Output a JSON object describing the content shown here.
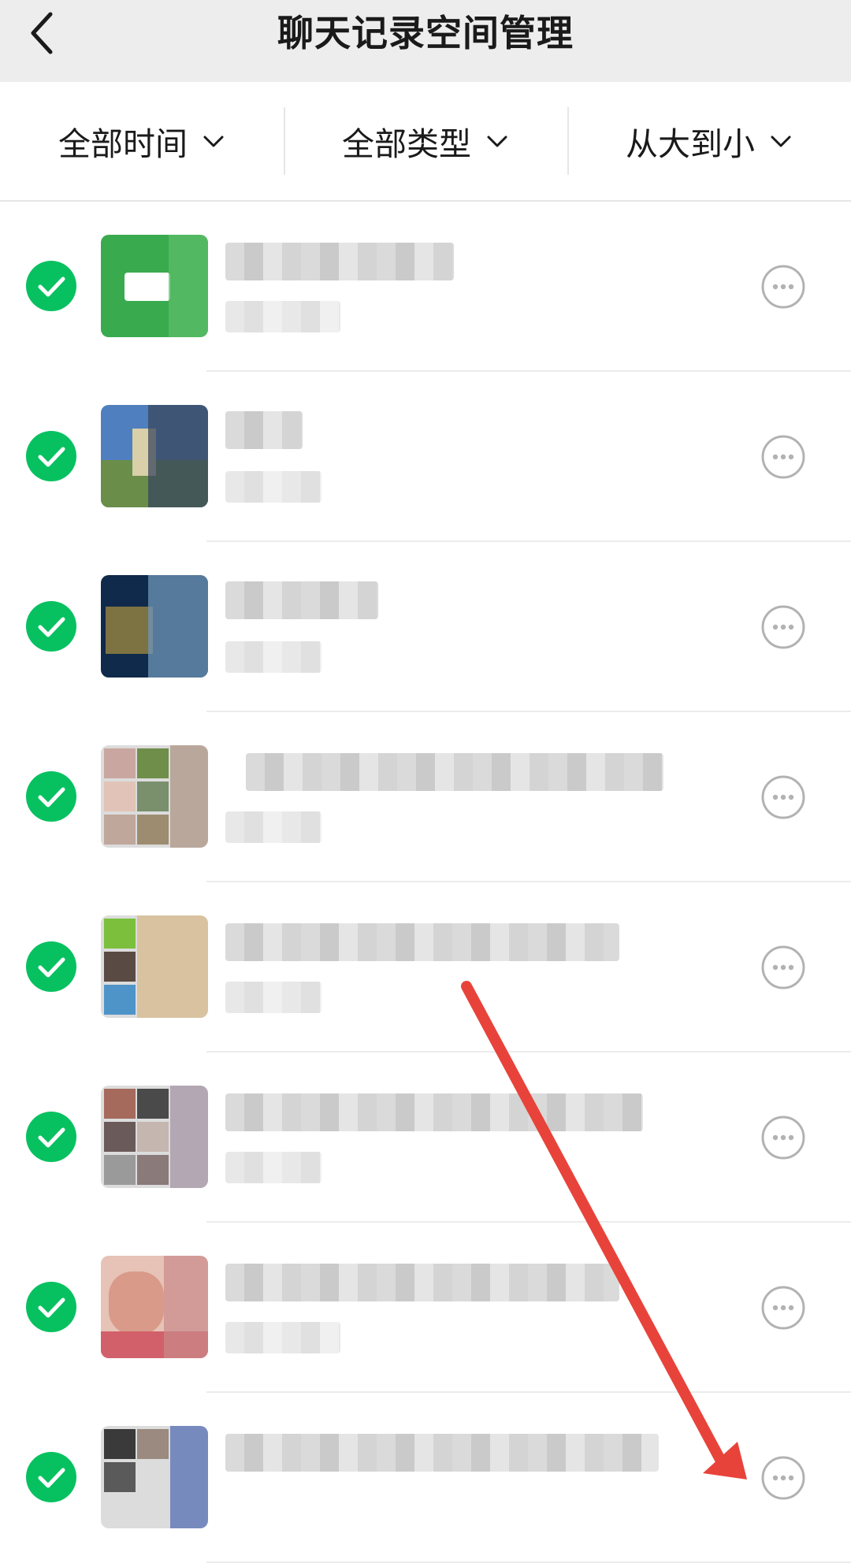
{
  "header": {
    "title": "聊天记录空间管理",
    "back_icon": "chevron-left-icon"
  },
  "filters": [
    {
      "label": "全部时间",
      "icon": "chevron-down-icon"
    },
    {
      "label": "全部类型",
      "icon": "chevron-down-icon"
    },
    {
      "label": "从大到小",
      "icon": "chevron-down-icon"
    }
  ],
  "colors": {
    "header_bg": "#ededed",
    "check_green": "#07c160",
    "annotation_red": "#e8433a",
    "more_gray": "#b2b2b2"
  },
  "list": {
    "row_count": 8,
    "items": [
      {
        "selected": true,
        "more_icon": "more-horizontal-icon"
      },
      {
        "selected": true,
        "more_icon": "more-horizontal-icon"
      },
      {
        "selected": true,
        "more_icon": "more-horizontal-icon"
      },
      {
        "selected": true,
        "more_icon": "more-horizontal-icon"
      },
      {
        "selected": true,
        "more_icon": "more-horizontal-icon"
      },
      {
        "selected": true,
        "more_icon": "more-horizontal-icon"
      },
      {
        "selected": true,
        "more_icon": "more-horizontal-icon"
      },
      {
        "selected": true,
        "more_icon": "more-horizontal-icon"
      }
    ]
  }
}
